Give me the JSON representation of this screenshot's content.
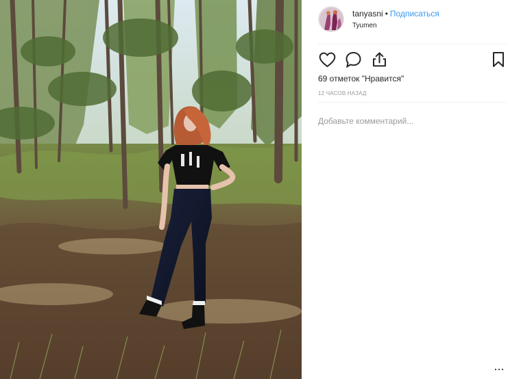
{
  "post": {
    "username": "tanyasni",
    "separator": "•",
    "follow_label": "Подписаться",
    "location": "Tyumen",
    "likes_text": "69 отметок \"Нравится\"",
    "timestamp": "12 ЧАСОВ НАЗАД",
    "comment_placeholder": "Добавьте комментарий...",
    "more_label": "..."
  },
  "icons": {
    "avatar": "avatar",
    "photo": "forest-photo",
    "like": "heart-icon",
    "comment": "speech-bubble-icon",
    "share": "share-icon",
    "save": "bookmark-icon",
    "more": "more-icon"
  },
  "colors": {
    "link": "#3897f0",
    "text": "#262626",
    "muted": "#999999",
    "divider": "#efefef"
  }
}
